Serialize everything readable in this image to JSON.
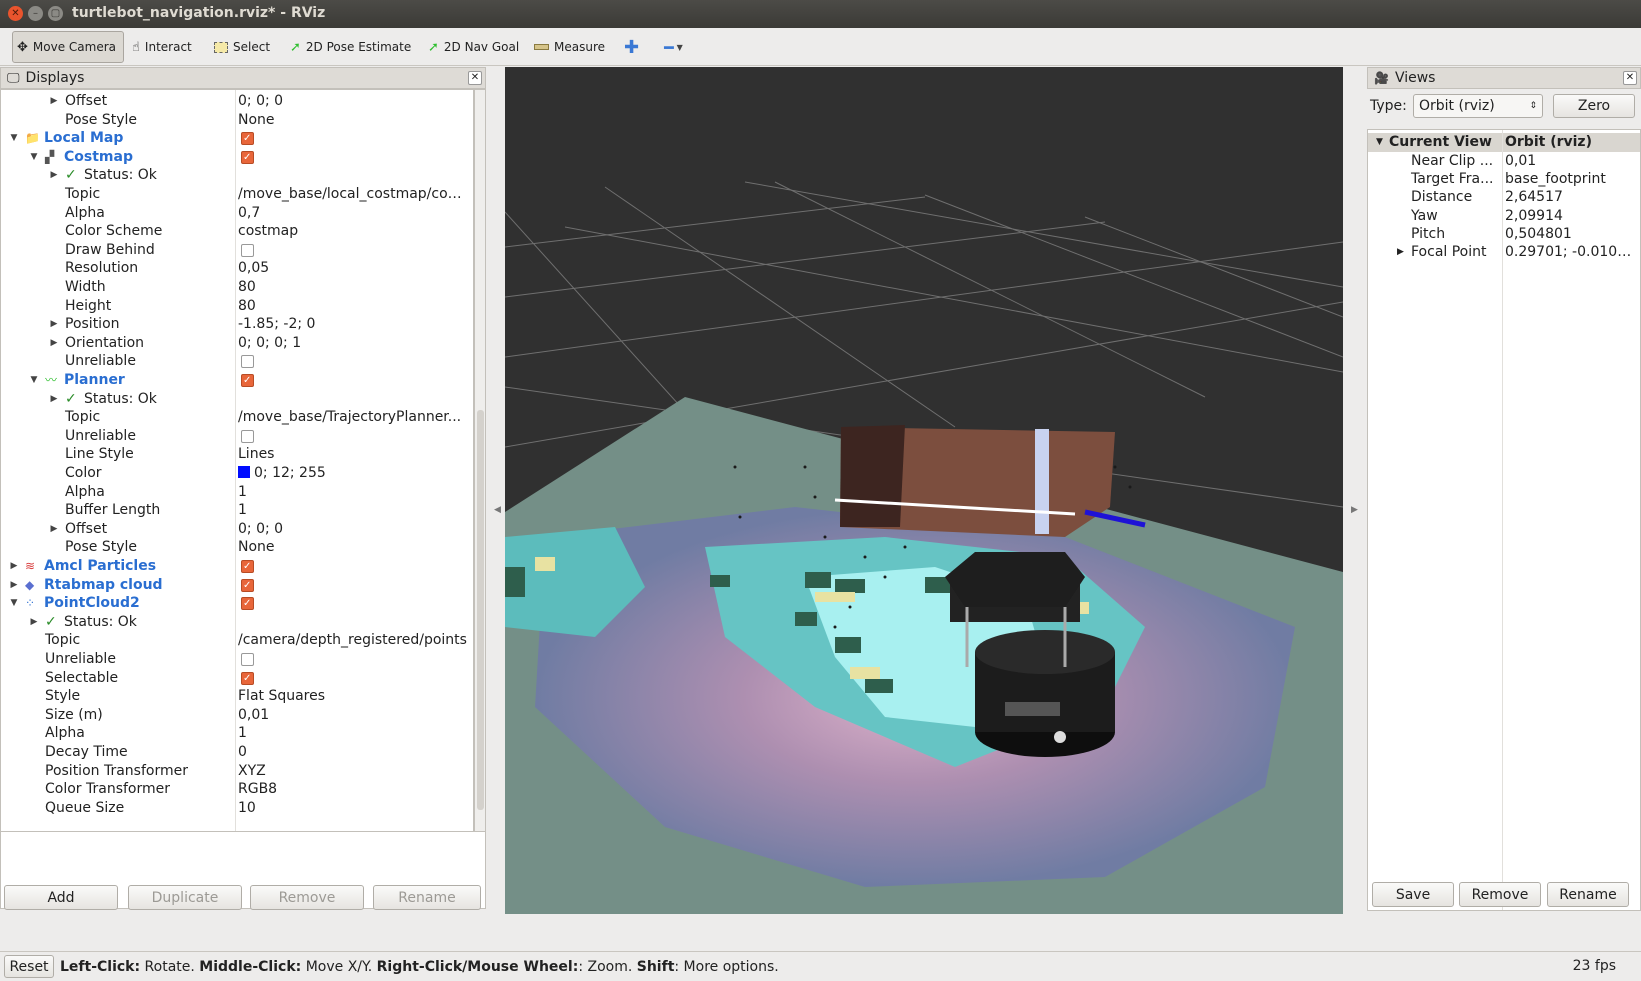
{
  "window": {
    "title": "turtlebot_navigation.rviz* - RViz"
  },
  "toolbar": {
    "move_camera": "Move Camera",
    "interact": "Interact",
    "select": "Select",
    "pose_estimate": "2D Pose Estimate",
    "nav_goal": "2D Nav Goal",
    "measure": "Measure"
  },
  "displays": {
    "title": "Displays",
    "rows": [
      {
        "indent": 2,
        "arrow": "right",
        "name": "Offset",
        "value": "0; 0; 0"
      },
      {
        "indent": 2,
        "arrow": "",
        "name": "Pose Style",
        "value": "None"
      },
      {
        "indent": 0,
        "arrow": "down",
        "icon": "folder-icon",
        "name": "Local Map",
        "group": true,
        "checked": true
      },
      {
        "indent": 1,
        "arrow": "down",
        "icon": "map-icon",
        "name": "Costmap",
        "group": true,
        "checked": true
      },
      {
        "indent": 2,
        "arrow": "right",
        "status": true,
        "name": "Status: Ok",
        "value": ""
      },
      {
        "indent": 2,
        "arrow": "",
        "name": "Topic",
        "value": "/move_base/local_costmap/cos..."
      },
      {
        "indent": 2,
        "arrow": "",
        "name": "Alpha",
        "value": "0,7"
      },
      {
        "indent": 2,
        "arrow": "",
        "name": "Color Scheme",
        "value": "costmap"
      },
      {
        "indent": 2,
        "arrow": "",
        "name": "Draw Behind",
        "checked": false
      },
      {
        "indent": 2,
        "arrow": "",
        "name": "Resolution",
        "value": "0,05"
      },
      {
        "indent": 2,
        "arrow": "",
        "name": "Width",
        "value": "80"
      },
      {
        "indent": 2,
        "arrow": "",
        "name": "Height",
        "value": "80"
      },
      {
        "indent": 2,
        "arrow": "right",
        "name": "Position",
        "value": "-1.85; -2; 0"
      },
      {
        "indent": 2,
        "arrow": "right",
        "name": "Orientation",
        "value": "0; 0; 0; 1"
      },
      {
        "indent": 2,
        "arrow": "",
        "name": "Unreliable",
        "checked": false
      },
      {
        "indent": 1,
        "arrow": "down",
        "icon": "path-icon",
        "name": "Planner",
        "group": true,
        "checked": true
      },
      {
        "indent": 2,
        "arrow": "right",
        "status": true,
        "name": "Status: Ok",
        "value": ""
      },
      {
        "indent": 2,
        "arrow": "",
        "name": "Topic",
        "value": "/move_base/TrajectoryPlanner..."
      },
      {
        "indent": 2,
        "arrow": "",
        "name": "Unreliable",
        "checked": false
      },
      {
        "indent": 2,
        "arrow": "",
        "name": "Line Style",
        "value": "Lines"
      },
      {
        "indent": 2,
        "arrow": "",
        "name": "Color",
        "value": "0; 12; 255",
        "swatch": "#000cff"
      },
      {
        "indent": 2,
        "arrow": "",
        "name": "Alpha",
        "value": "1"
      },
      {
        "indent": 2,
        "arrow": "",
        "name": "Buffer Length",
        "value": "1"
      },
      {
        "indent": 2,
        "arrow": "right",
        "name": "Offset",
        "value": "0; 0; 0"
      },
      {
        "indent": 2,
        "arrow": "",
        "name": "Pose Style",
        "value": "None"
      },
      {
        "indent": 0,
        "arrow": "right",
        "icon": "particles-icon",
        "name": "Amcl Particles",
        "group": true,
        "checked": true
      },
      {
        "indent": 0,
        "arrow": "right",
        "icon": "cloud-icon",
        "name": "Rtabmap cloud",
        "group": true,
        "checked": true
      },
      {
        "indent": 0,
        "arrow": "down",
        "icon": "pointcloud-icon",
        "name": "PointCloud2",
        "group": true,
        "checked": true
      },
      {
        "indent": 1,
        "arrow": "right",
        "status": true,
        "name": "Status: Ok",
        "value": ""
      },
      {
        "indent": 1,
        "arrow": "",
        "name": "Topic",
        "value": "/camera/depth_registered/points"
      },
      {
        "indent": 1,
        "arrow": "",
        "name": "Unreliable",
        "checked": false
      },
      {
        "indent": 1,
        "arrow": "",
        "name": "Selectable",
        "checked": true
      },
      {
        "indent": 1,
        "arrow": "",
        "name": "Style",
        "value": "Flat Squares"
      },
      {
        "indent": 1,
        "arrow": "",
        "name": "Size (m)",
        "value": "0,01"
      },
      {
        "indent": 1,
        "arrow": "",
        "name": "Alpha",
        "value": "1"
      },
      {
        "indent": 1,
        "arrow": "",
        "name": "Decay Time",
        "value": "0"
      },
      {
        "indent": 1,
        "arrow": "",
        "name": "Position Transformer",
        "value": "XYZ"
      },
      {
        "indent": 1,
        "arrow": "",
        "name": "Color Transformer",
        "value": "RGB8"
      },
      {
        "indent": 1,
        "arrow": "",
        "name": "Queue Size",
        "value": "10"
      }
    ],
    "buttons": {
      "add": "Add",
      "duplicate": "Duplicate",
      "remove": "Remove",
      "rename": "Rename"
    }
  },
  "views": {
    "title": "Views",
    "type_label": "Type:",
    "type_value": "Orbit (rviz)",
    "zero": "Zero",
    "header": {
      "name": "Current View",
      "value": "Orbit (rviz)"
    },
    "rows": [
      {
        "name": "Near Clip ...",
        "value": "0,01",
        "arrow": ""
      },
      {
        "name": "Target Fra...",
        "value": "base_footprint",
        "arrow": ""
      },
      {
        "name": "Distance",
        "value": "2,64517",
        "arrow": ""
      },
      {
        "name": "Yaw",
        "value": "2,09914",
        "arrow": ""
      },
      {
        "name": "Pitch",
        "value": "0,504801",
        "arrow": ""
      },
      {
        "name": "Focal Point",
        "value": "0.29701; -0.0100...",
        "arrow": "right"
      }
    ],
    "buttons": {
      "save": "Save",
      "remove": "Remove",
      "rename": "Rename"
    }
  },
  "status": {
    "reset": "Reset",
    "hint_parts": [
      {
        "b": "Left-Click:",
        "t": " Rotate. "
      },
      {
        "b": "Middle-Click:",
        "t": " Move X/Y. "
      },
      {
        "b": "Right-Click/Mouse Wheel:",
        "t": ": Zoom. "
      },
      {
        "b": "Shift",
        "t": ": More options."
      }
    ],
    "fps": "23 fps"
  }
}
